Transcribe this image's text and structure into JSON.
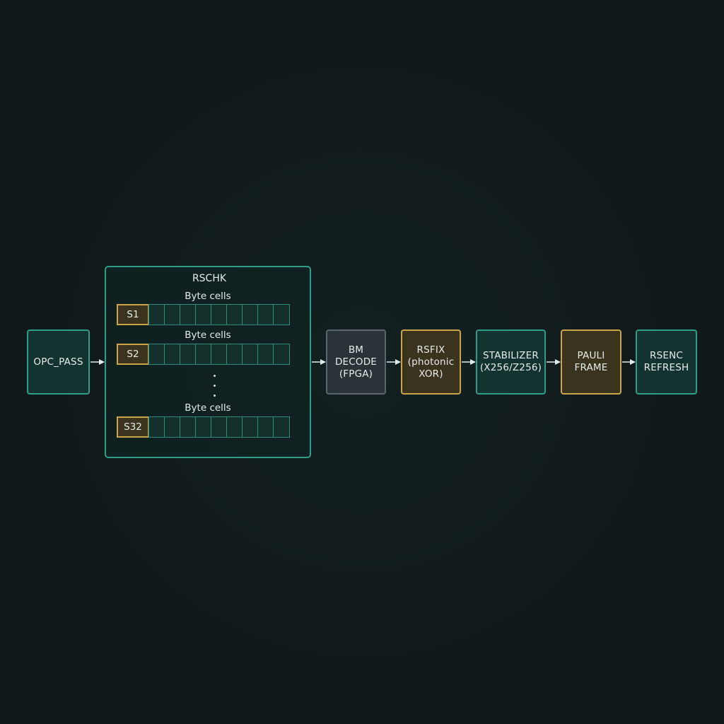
{
  "nodes": {
    "opc_pass": "OPC_PASS",
    "bm_decode": "BM\nDECODE\n(FPGA)",
    "rsfix": "RSFIX\n(photonic\nXOR)",
    "stabilizer": "STABILIZER\n(X256/Z256)",
    "pauli_frame": "PAULI\nFRAME",
    "rsenc_refresh": "RSENC\nREFRESH"
  },
  "rschk": {
    "title": "RSCHK",
    "rows": [
      {
        "caption": "Byte cells",
        "slot": "S1"
      },
      {
        "caption": "Byte cells",
        "slot": "S2"
      },
      {
        "caption": "Byte cells",
        "slot": "S32"
      }
    ]
  },
  "colors": {
    "teal_border": "#2f9c86",
    "amber_border": "#c9a546",
    "gray_border": "#5b676c",
    "background": "#111a1b",
    "arrow": "#e6ecea"
  }
}
